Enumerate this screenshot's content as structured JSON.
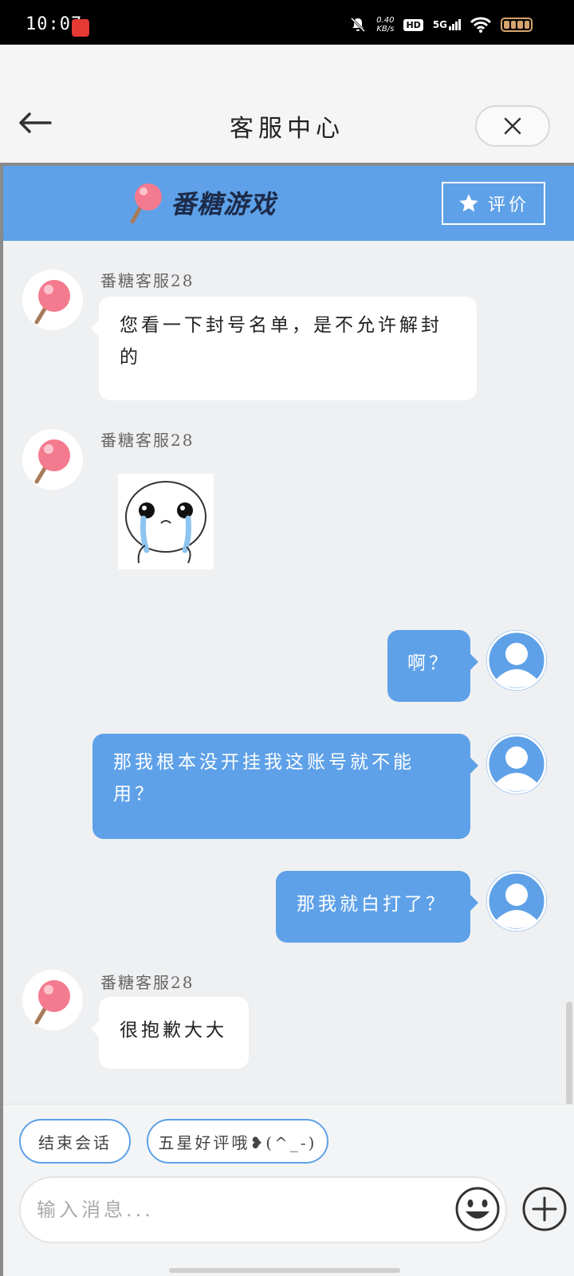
{
  "status_bar": {
    "time": "10:07",
    "net_speed_value": "0.40",
    "net_speed_unit": "KB/s",
    "hd": "HD",
    "network": "5G"
  },
  "header": {
    "title": "客服中心",
    "back_icon": "arrow-left-icon",
    "close_icon": "close-icon"
  },
  "brand": {
    "name": "番糖游戏",
    "rate_label": "评价",
    "accent_color": "#5ea1e8"
  },
  "messages": [
    {
      "side": "left",
      "sender": "番糖客服28",
      "text": "您看一下封号名单，是不允许解封的"
    },
    {
      "side": "left",
      "sender": "番糖客服28",
      "type": "sticker",
      "sticker": "crying-face-icon"
    },
    {
      "side": "right",
      "text": "啊？"
    },
    {
      "side": "right",
      "text": "那我根本没开挂我这账号就不能用？"
    },
    {
      "side": "right",
      "text": "那我就白打了？"
    },
    {
      "side": "left",
      "sender": "番糖客服28",
      "text": "很抱歉大大"
    }
  ],
  "quick_replies": [
    "结束会话",
    "五星好评哦❥(^_-)"
  ],
  "composer": {
    "placeholder": "输入消息...",
    "value": ""
  }
}
